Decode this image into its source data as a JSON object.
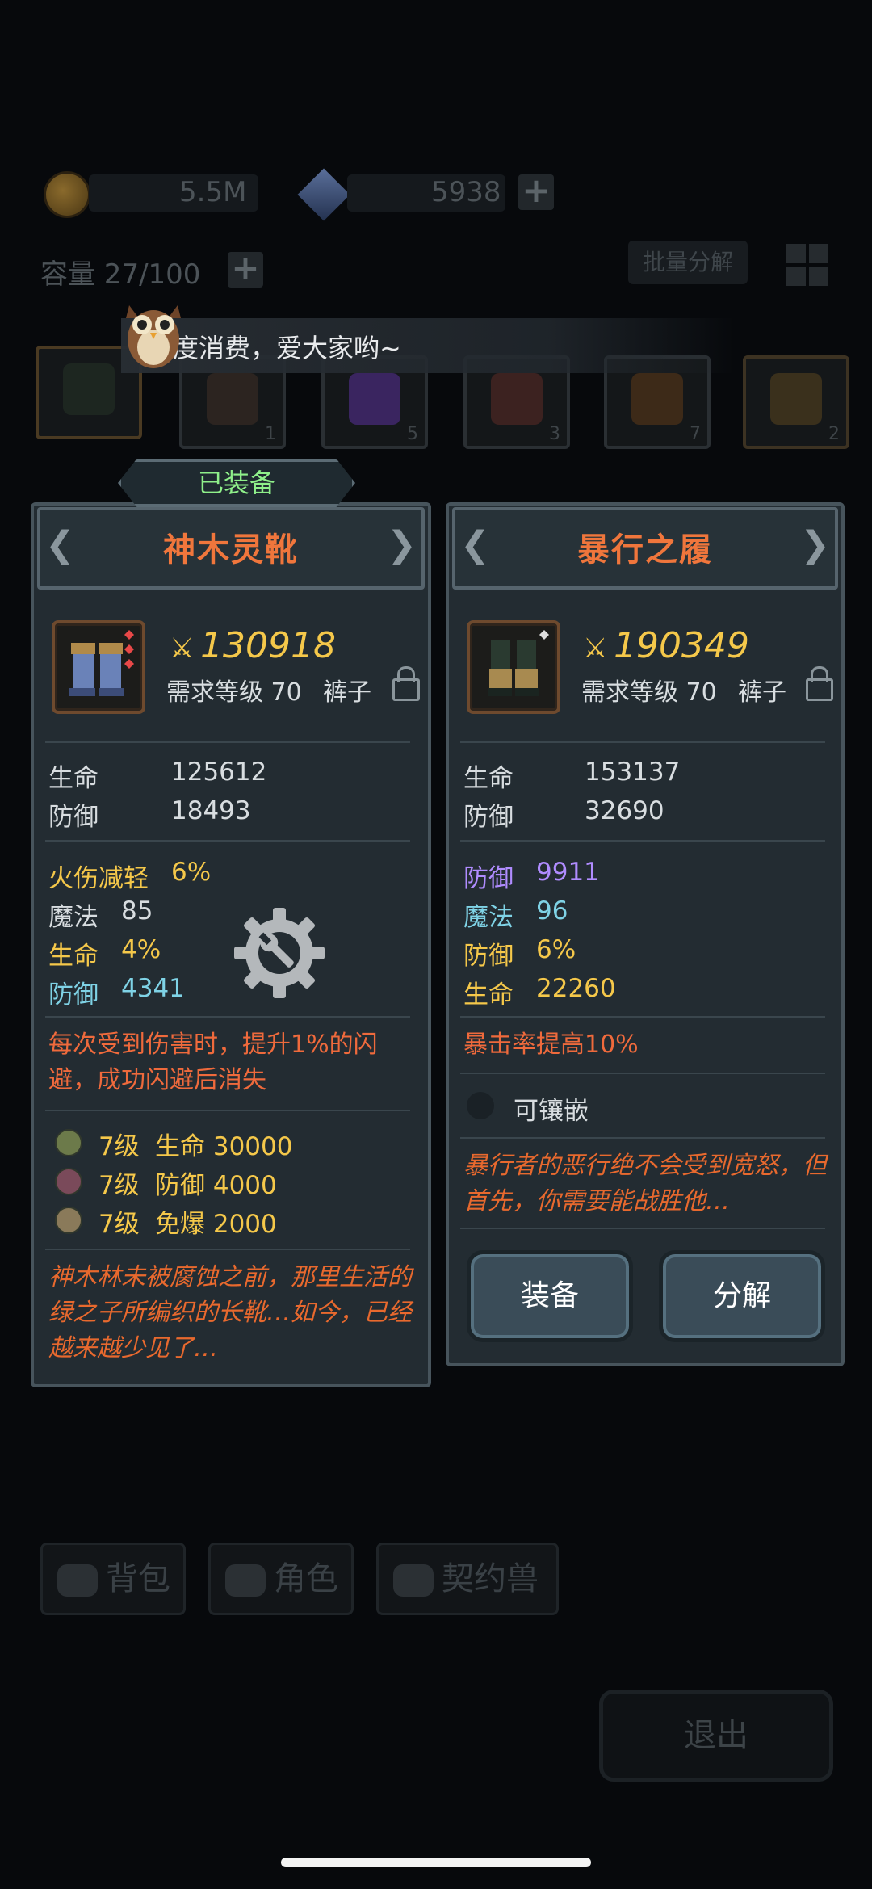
{
  "currency": {
    "gold": "5.5M",
    "crystal": "5938"
  },
  "inventory": {
    "capacity": "容量 27/100",
    "bulk_decompose": "批量分解",
    "slot_counts": [
      "1",
      "5",
      "3",
      "7",
      "2"
    ]
  },
  "toast": {
    "message": "度消费，爱大家哟~"
  },
  "equipped_label": "已装备",
  "left_item": {
    "name": "神木灵靴",
    "score": "130918",
    "req_level": "需求等级 70",
    "type": "裤子",
    "base_stats": [
      {
        "label": "生命",
        "value": "125612"
      },
      {
        "label": "防御",
        "value": "18493"
      }
    ],
    "extra_stats": [
      {
        "label": "火伤减轻",
        "value": "6%",
        "color": "#f5c84a"
      },
      {
        "label": "魔法",
        "value": "85",
        "color": "#d8dde0"
      },
      {
        "label": "生命",
        "value": "4%",
        "color": "#f5c84a"
      },
      {
        "label": "防御",
        "value": "4341",
        "color": "#7fd3e6"
      }
    ],
    "special": "每次受到伤害时，提升1%的闪避，成功闪避后消失",
    "gems": [
      {
        "level": "7级",
        "stat": "生命 30000"
      },
      {
        "level": "7级",
        "stat": "防御 4000"
      },
      {
        "level": "7级",
        "stat": "免爆 2000"
      }
    ],
    "lore": "神木林未被腐蚀之前，那里生活的绿之子所编织的长靴…如今，已经越来越少见了…"
  },
  "right_item": {
    "name": "暴行之履",
    "score": "190349",
    "req_level": "需求等级 70",
    "type": "裤子",
    "base_stats": [
      {
        "label": "生命",
        "value": "153137"
      },
      {
        "label": "防御",
        "value": "32690"
      }
    ],
    "extra_stats": [
      {
        "label": "防御",
        "value": "9911",
        "color": "#b08cff"
      },
      {
        "label": "魔法",
        "value": "96",
        "color": "#7fd3e6"
      },
      {
        "label": "防御",
        "value": "6%",
        "color": "#f5c84a"
      },
      {
        "label": "生命",
        "value": "22260",
        "color": "#f5c84a"
      }
    ],
    "special": "暴击率提高10%",
    "socket_label": "可镶嵌",
    "lore": "暴行者的恶行绝不会受到宽怒，但首先，你需要能战胜他…",
    "equip_button": "装备",
    "decompose_button": "分解"
  },
  "tabs": [
    "背包",
    "角色",
    "契约兽"
  ],
  "exit_button": "退出",
  "icons": [
    "gold-coin-icon",
    "crystal-icon",
    "settings-icon",
    "lock-icon",
    "owl-icon"
  ]
}
